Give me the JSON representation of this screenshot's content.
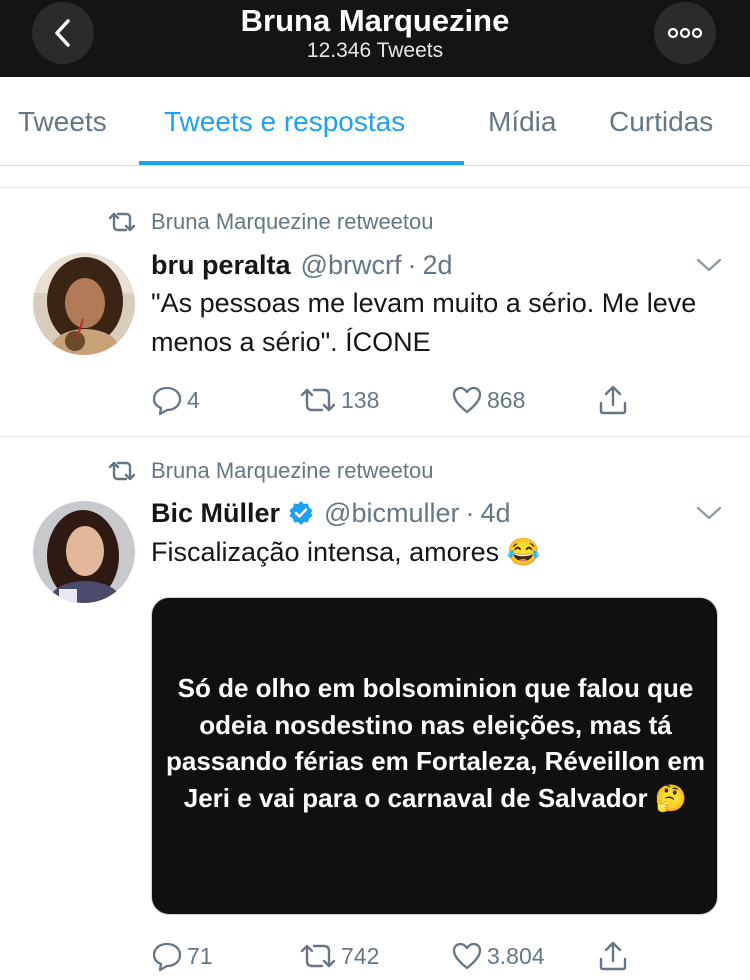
{
  "header": {
    "title": "Bruna Marquezine",
    "subtitle": "12.346 Tweets"
  },
  "tabs": [
    {
      "label": "Tweets",
      "active": false
    },
    {
      "label": "Tweets e respostas",
      "active": true
    },
    {
      "label": "Mídia",
      "active": false
    },
    {
      "label": "Curtidas",
      "active": false
    }
  ],
  "colors": {
    "accent": "#1da1f2",
    "header_bg": "#141414",
    "muted": "#657786"
  },
  "tweets": [
    {
      "retweeted_by": "Bruna Marquezine retweetou",
      "name": "bru peralta",
      "verified": false,
      "handle": "@brwcrf",
      "age": "2d",
      "text": "\"As pessoas me levam muito a sério. Me leve menos a sério\". ÍCONE",
      "replies": "4",
      "retweets": "138",
      "likes": "868"
    },
    {
      "retweeted_by": "Bruna Marquezine retweetou",
      "name": "Bic Müller",
      "verified": true,
      "handle": "@bicmuller",
      "age": "4d",
      "text": "Fiscalização intensa, amores 😂",
      "media_text": "Só de olho em bolsominion que falou que odeia nosdestino nas eleições, mas tá passando férias em Fortaleza, Réveillon em Jeri e vai para o carnaval de Salvador 🤔",
      "replies": "71",
      "retweets": "742",
      "likes": "3.804"
    }
  ]
}
